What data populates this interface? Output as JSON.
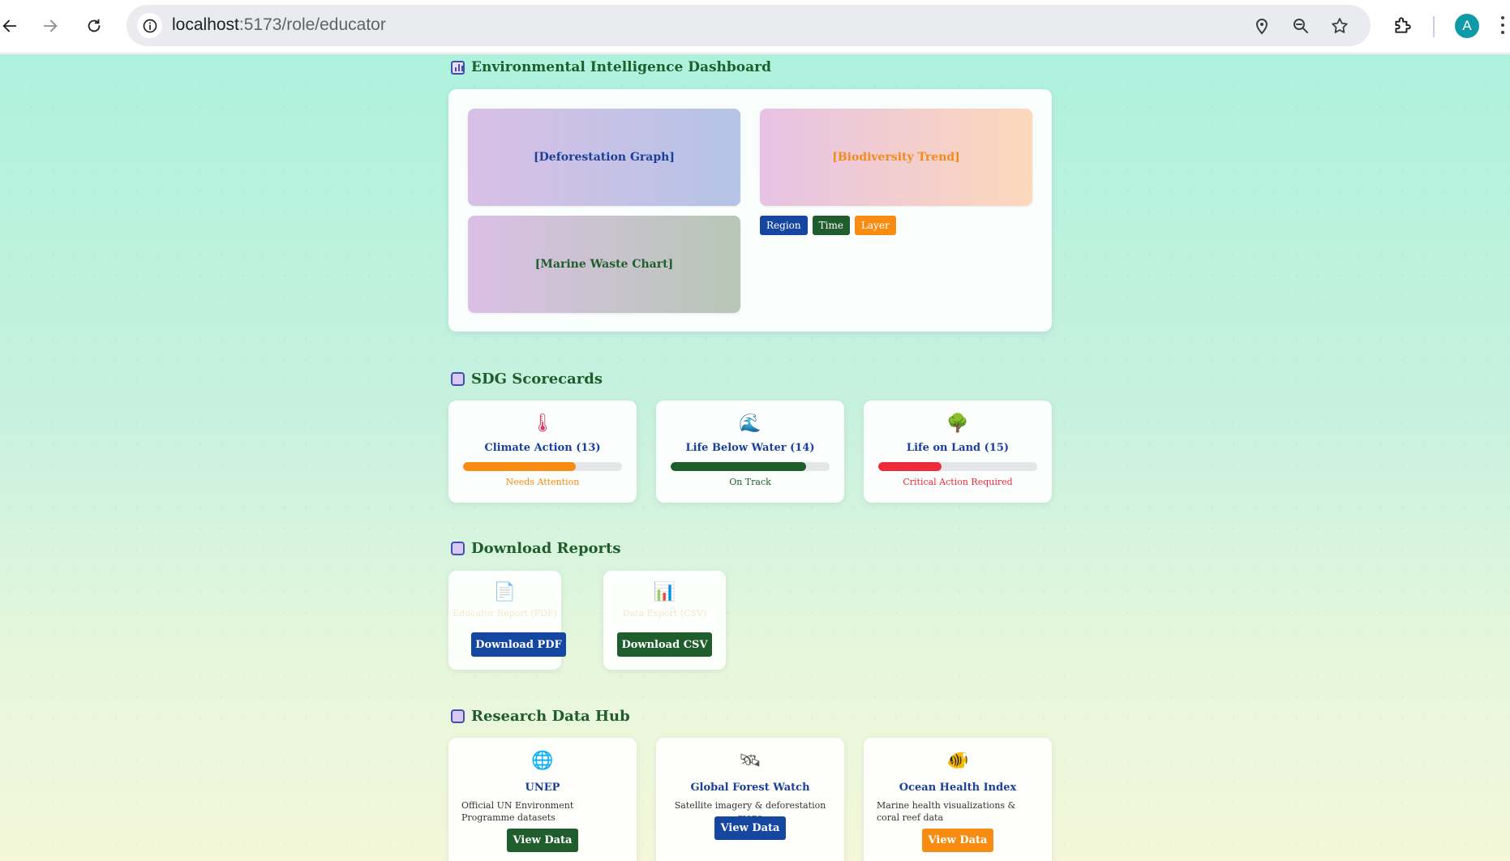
{
  "browser": {
    "url_host": "localhost",
    "url_path": ":5173/role/educator",
    "profile_initial": "A"
  },
  "dashboard": {
    "title": "Environmental Intelligence Dashboard",
    "tiles": {
      "deforestation": "[Deforestation Graph]",
      "biodiversity": "[Biodiversity Trend]",
      "marine": "[Marine Waste Chart]"
    },
    "filters": {
      "region": "Region",
      "time": "Time",
      "layer": "Layer"
    }
  },
  "sdg": {
    "title": "SDG Scorecards",
    "cards": [
      {
        "icon": "thermometer-icon",
        "name": "Climate Action (13)",
        "progress": 0.71,
        "status": "Needs Attention",
        "color": "#f88c12"
      },
      {
        "icon": "wave-icon",
        "name": "Life Below Water (14)",
        "progress": 0.85,
        "status": "On Track",
        "color": "#1f5e2c"
      },
      {
        "icon": "tree-icon",
        "name": "Life on Land (15)",
        "progress": 0.4,
        "status": "Critical Action Required",
        "color": "#ee2b3b"
      }
    ]
  },
  "reports": {
    "title": "Download Reports",
    "items": [
      {
        "icon": "document-icon",
        "faint_label": "Educator Report (PDF)",
        "button": "Download PDF"
      },
      {
        "icon": "bar-chart-icon",
        "faint_label": "Data Export (CSV)",
        "button": "Download CSV"
      }
    ]
  },
  "research": {
    "title": "Research Data Hub",
    "items": [
      {
        "icon": "globe-icon",
        "name": "UNEP",
        "desc": "Official UN Environment Programme datasets",
        "button": "View Data"
      },
      {
        "icon": "satellite-icon",
        "name": "Global Forest Watch",
        "desc": "Satellite imagery & deforestation maps",
        "button": "View Data"
      },
      {
        "icon": "fish-icon",
        "name": "Ocean Health Index",
        "desc": "Marine health visualizations & coral reef data",
        "button": "View Data"
      }
    ]
  }
}
